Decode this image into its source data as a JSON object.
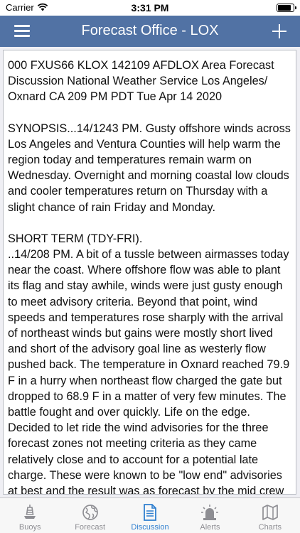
{
  "status_bar": {
    "carrier": "Carrier",
    "time": "3:31 PM",
    "battery_level": 0.9
  },
  "nav": {
    "title": "Forecast Office - LOX",
    "menu_icon": "hamburger-menu-icon",
    "add_icon": "plus-icon"
  },
  "discussion": {
    "header": "000 FXUS66 KLOX 142109 AFDLOX  Area Forecast Discussion National Weather Service Los Angeles/ Oxnard CA 209 PM PDT Tue Apr 14 2020",
    "synopsis": "SYNOPSIS...14/1243 PM.  Gusty offshore winds across Los Angeles and Ventura Counties will help warm the region today and temperatures remain warm on Wednesday. Overnight and morning coastal low clouds and cooler temperatures return on Thursday with a slight chance of rain Friday and Monday.",
    "short_term_heading": "SHORT TERM (TDY-FRI).",
    "short_term_body": "..14/208 PM.  A bit of a tussle between airmasses today near the coast. Where offshore flow was able to plant its flag and stay awhile, winds were just gusty enough to meet advisory criteria. Beyond that point, wind speeds and temperatures rose sharply with the arrival of northeast winds but gains were mostly short lived and short of the advisory goal line as westerly flow pushed back. The temperature in Oxnard reached 79.9 F in a hurry when northeast flow charged the gate but dropped to 68.9 F in a matter of very few minutes. The battle fought and over quickly. Life on the edge. Decided to let ride the wind advisories for the three forecast zones not meeting criteria as they came relatively close and to account for a potential late charge. These were known to be \"low end\" advisories at best and the result was as forecast by the mid crew"
  },
  "tabs": [
    {
      "label": "Buoys",
      "icon": "buoy-icon",
      "active": false
    },
    {
      "label": "Forecast",
      "icon": "globe-icon",
      "active": false
    },
    {
      "label": "Discussion",
      "icon": "document-icon",
      "active": true
    },
    {
      "label": "Alerts",
      "icon": "alarm-icon",
      "active": false
    },
    {
      "label": "Charts",
      "icon": "map-icon",
      "active": false
    }
  ],
  "colors": {
    "nav_bar": "#5172a4",
    "tab_active": "#2f7fcf",
    "tab_inactive": "#8e8e93"
  }
}
